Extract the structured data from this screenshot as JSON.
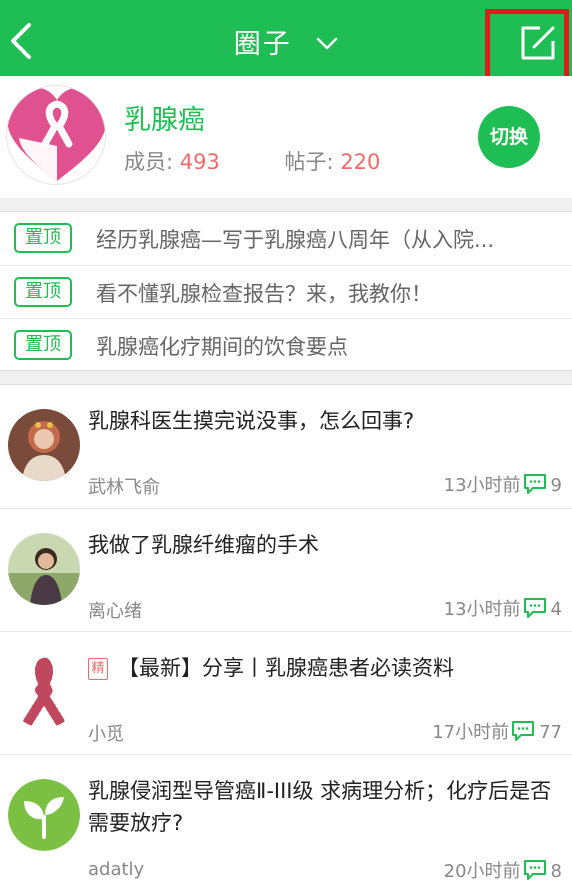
{
  "header": {
    "title": "圈子",
    "back_icon": "chevron-left-icon",
    "compose_icon": "compose-icon",
    "colors": {
      "bar": "#1fbe55",
      "highlight_border": "#e01b1b"
    }
  },
  "circle": {
    "name": "乳腺癌",
    "members_label": "成员:",
    "members_count": "493",
    "posts_label": "帖子:",
    "posts_count": "220",
    "switch_label": "切换",
    "logo_icon": "pink-ribbon-heart-logo"
  },
  "pinned": {
    "badge_label": "置顶",
    "items": [
      {
        "title": "经历乳腺癌—写于乳腺癌八周年（从入院..."
      },
      {
        "title": "看不懂乳腺检查报告？来，我教你！"
      },
      {
        "title": "乳腺癌化疗期间的饮食要点"
      }
    ]
  },
  "posts": [
    {
      "title": "乳腺科医生摸完说没事，怎么回事?",
      "author": "武林飞俞",
      "time": "13小时前",
      "comments": "9",
      "badge": "",
      "avatar_icon": "statue-avatar"
    },
    {
      "title": "我做了乳腺纤维瘤的手术",
      "author": "离心绪",
      "time": "13小时前",
      "comments": "4",
      "badge": "",
      "avatar_icon": "person-avatar"
    },
    {
      "title": "【最新】分享丨乳腺癌患者必读资料",
      "author": "小觅",
      "time": "17小时前",
      "comments": "77",
      "badge": "精",
      "avatar_icon": "ribbon-avatar"
    },
    {
      "title": "乳腺侵润型导管癌Ⅱ-III级 求病理分析；化疗后是否需要放疗?",
      "author": "adatly",
      "time": "20小时前",
      "comments": "8",
      "badge": "",
      "avatar_icon": "sprout-avatar"
    }
  ]
}
